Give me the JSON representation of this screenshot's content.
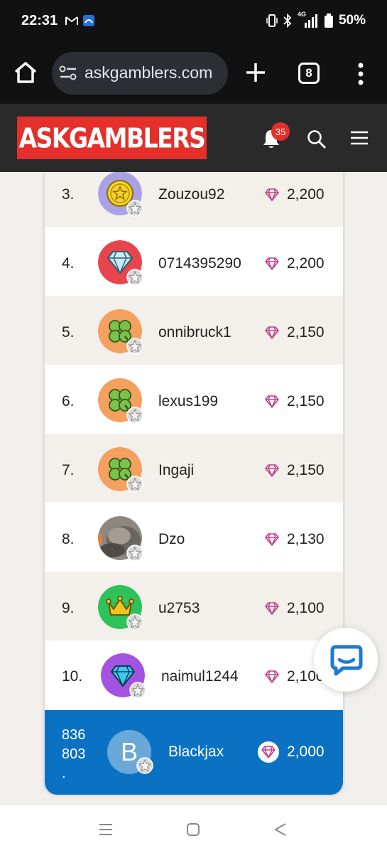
{
  "status_bar": {
    "time": "22:31",
    "signal_label": "4G",
    "battery": "50%"
  },
  "browser": {
    "url": "askgamblers.com",
    "tab_count": "8"
  },
  "site": {
    "logo_text": "ASKGAMBLERS",
    "notification_count": "35"
  },
  "leaderboard": {
    "rows": [
      {
        "rank": "3.",
        "name": "Zouzou92",
        "points": "2,200",
        "avatar": "coin-star-icon"
      },
      {
        "rank": "4.",
        "name": "0714395290",
        "points": "2,200",
        "avatar": "diamond-icon"
      },
      {
        "rank": "5.",
        "name": "onnibruck1",
        "points": "2,150",
        "avatar": "clover-icon"
      },
      {
        "rank": "6.",
        "name": "lexus199",
        "points": "2,150",
        "avatar": "clover-icon"
      },
      {
        "rank": "7.",
        "name": "Ingaji",
        "points": "2,150",
        "avatar": "clover-icon"
      },
      {
        "rank": "8.",
        "name": "Dzo",
        "points": "2,130",
        "avatar": "photo-avatar"
      },
      {
        "rank": "9.",
        "name": "u2753",
        "points": "2,100",
        "avatar": "crown-icon"
      },
      {
        "rank": "10.",
        "name": "naimul1244",
        "points": "2,100",
        "avatar": "gem-icon"
      }
    ],
    "current_user": {
      "rank_line1": "836",
      "rank_line2": "803",
      "rank_line3": ".",
      "initial": "B",
      "name": "Blackjax",
      "points": "2,000"
    }
  },
  "colors": {
    "brand_red": "#e52f2a",
    "self_row_blue": "#0b72c3",
    "gem_pink": "#c2428a"
  }
}
